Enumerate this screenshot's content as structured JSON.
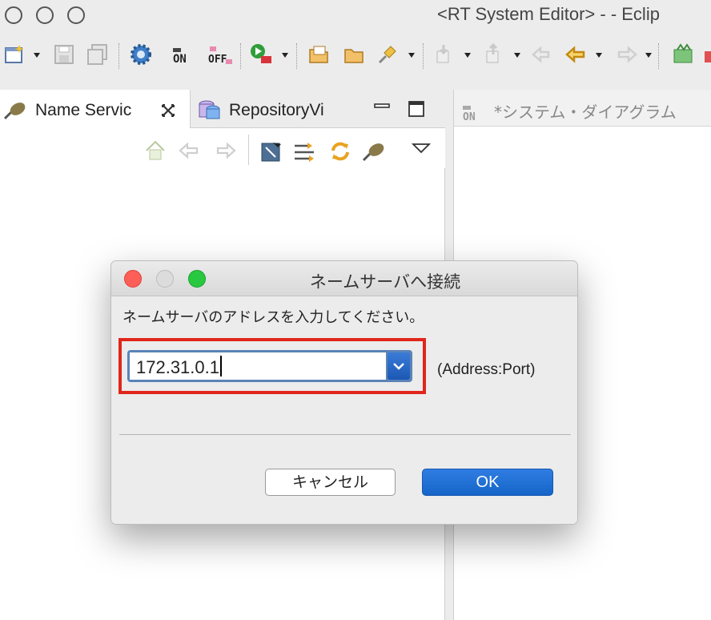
{
  "window": {
    "title": "<RT System Editor> -  - Eclip"
  },
  "toolbar": {
    "icons": [
      "new-wizard-icon",
      "save-icon",
      "save-all-icon",
      "gear-icon",
      "on-icon",
      "off-icon",
      "run-icon",
      "open-file-icon",
      "open-folder-icon",
      "pin-icon",
      "import-icon",
      "export-icon",
      "back-disabled-icon",
      "back-icon",
      "forward-icon",
      "build-icon"
    ],
    "on_label": "ON",
    "off_label": "OFF"
  },
  "left_view": {
    "tabs": [
      {
        "label": "Name Servic",
        "active": true
      },
      {
        "label": "RepositoryVi",
        "active": false
      }
    ],
    "view_tools": [
      "home-icon",
      "back-icon",
      "forward-icon",
      "connect-icon",
      "filter-icon",
      "refresh-icon",
      "plugin-icon",
      "view-menu-icon"
    ]
  },
  "editor": {
    "tab_label": "*システム・ダイアグラム"
  },
  "dialog": {
    "title": "ネームサーバへ接続",
    "message": "ネームサーバのアドレスを入力してください。",
    "address_value": "172.31.0.1",
    "address_hint": "(Address:Port)",
    "cancel_label": "キャンセル",
    "ok_label": "OK",
    "highlight_color": "#e0261b"
  }
}
